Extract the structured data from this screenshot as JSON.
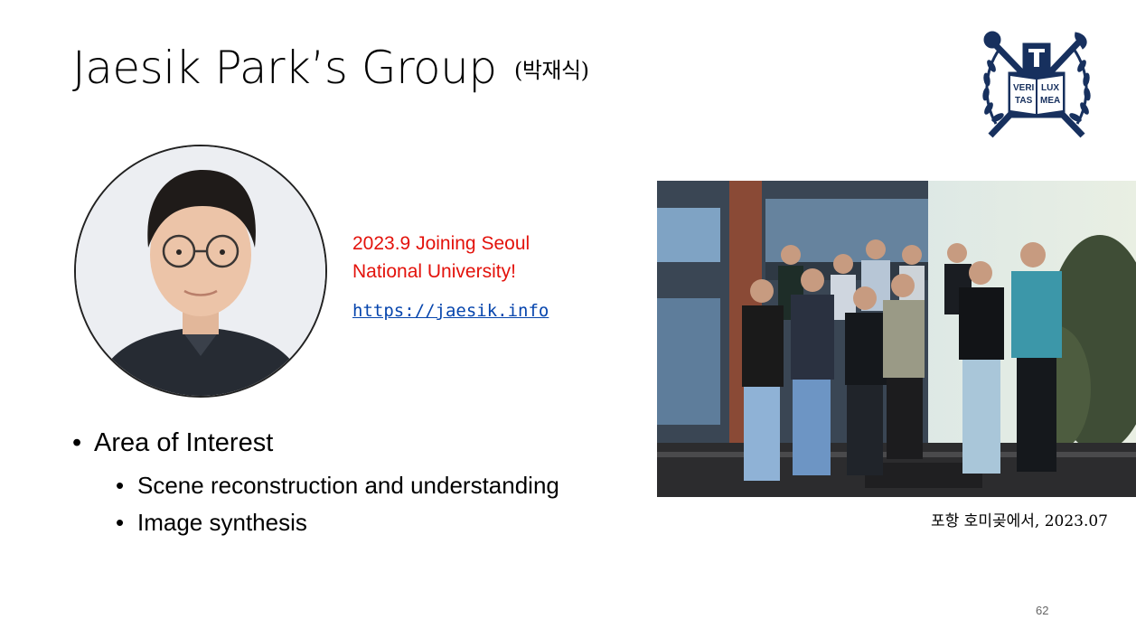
{
  "slide": {
    "title": "Jaesik Park’s Group",
    "title_korean": "(박재식)",
    "announcement": {
      "line1": "2023.9 Joining Seoul",
      "line2": "National University!",
      "color": "#e3120b"
    },
    "link_text": "https://jaesik.info",
    "area": {
      "heading": "Area of Interest",
      "items": [
        "Scene reconstruction and understanding",
        "Image synthesis"
      ]
    },
    "photo_caption": "포항 호미곶에서, 2023.07",
    "page_number": "62",
    "logo_text": [
      "VERI",
      "TAS",
      "LUX",
      "MEA"
    ],
    "colors": {
      "logo_navy": "#17305e",
      "link_blue": "#0645ad"
    }
  }
}
